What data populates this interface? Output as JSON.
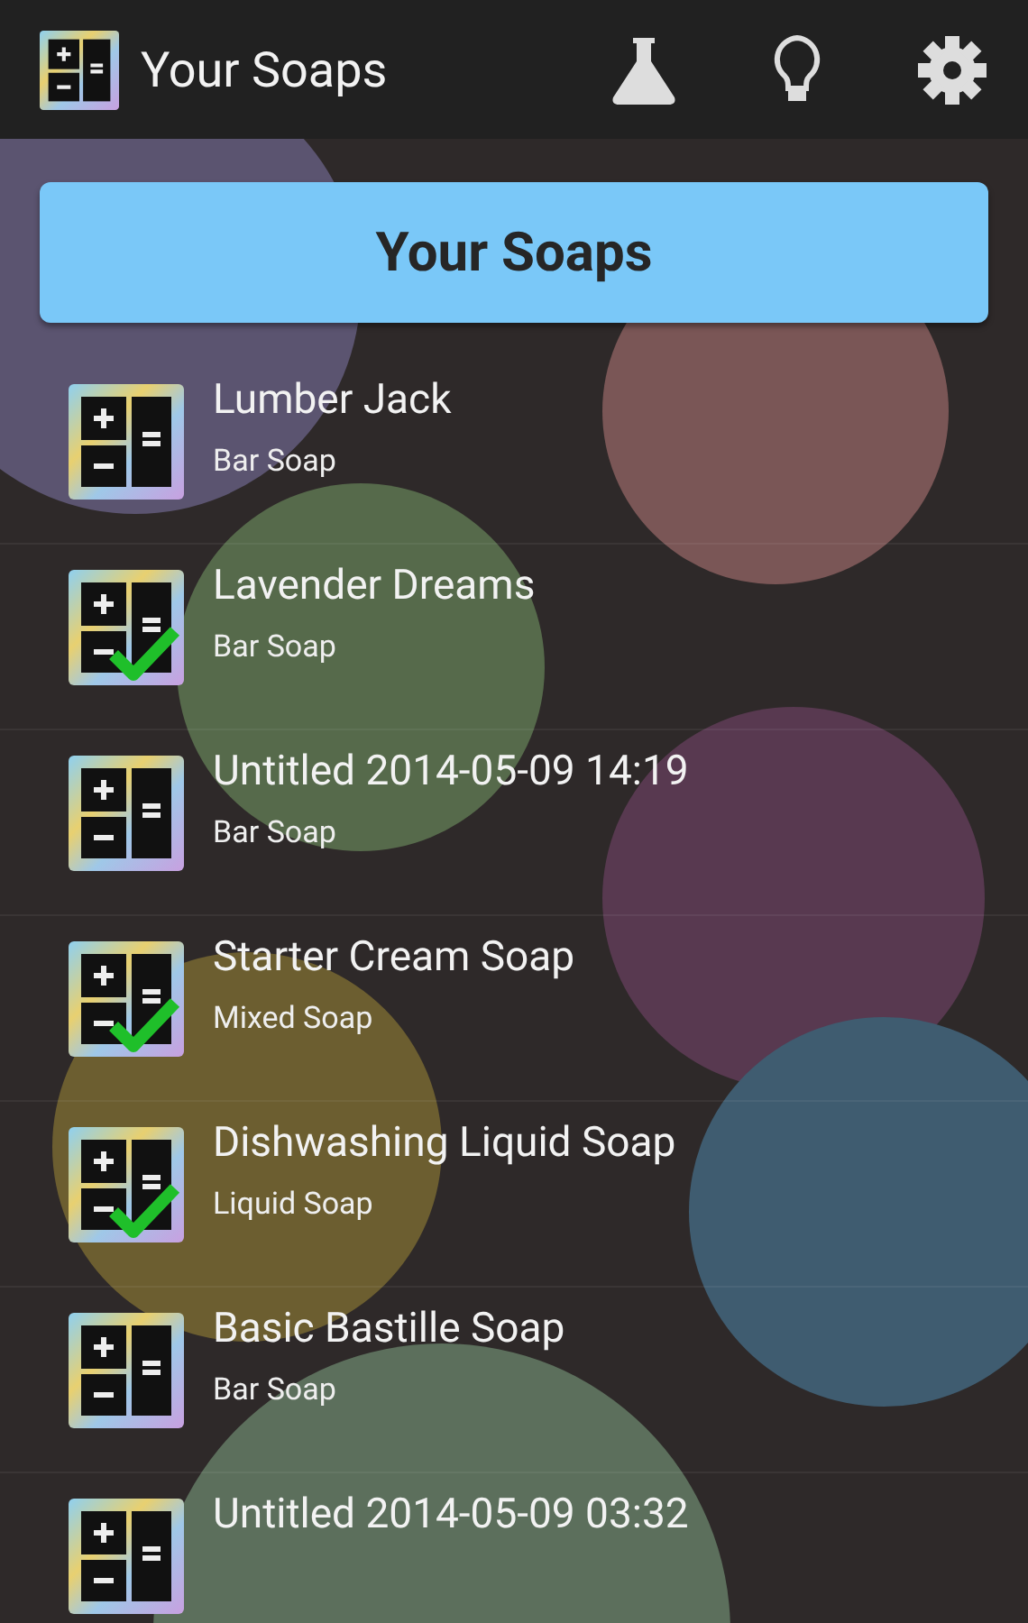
{
  "action_bar": {
    "title": "Your Soaps"
  },
  "banner": {
    "title": "Your Soaps"
  },
  "soaps": [
    {
      "name": "Lumber Jack",
      "type": "Bar Soap",
      "checked": false
    },
    {
      "name": "Lavender Dreams",
      "type": "Bar Soap",
      "checked": true
    },
    {
      "name": "Untitled 2014-05-09 14:19",
      "type": "Bar Soap",
      "checked": false
    },
    {
      "name": "Starter Cream Soap",
      "type": "Mixed Soap",
      "checked": true
    },
    {
      "name": "Dishwashing Liquid Soap",
      "type": "Liquid Soap",
      "checked": true
    },
    {
      "name": "Basic Bastille Soap",
      "type": "Bar Soap",
      "checked": false
    },
    {
      "name": "Untitled 2014-05-09 03:32",
      "checked": false
    }
  ]
}
